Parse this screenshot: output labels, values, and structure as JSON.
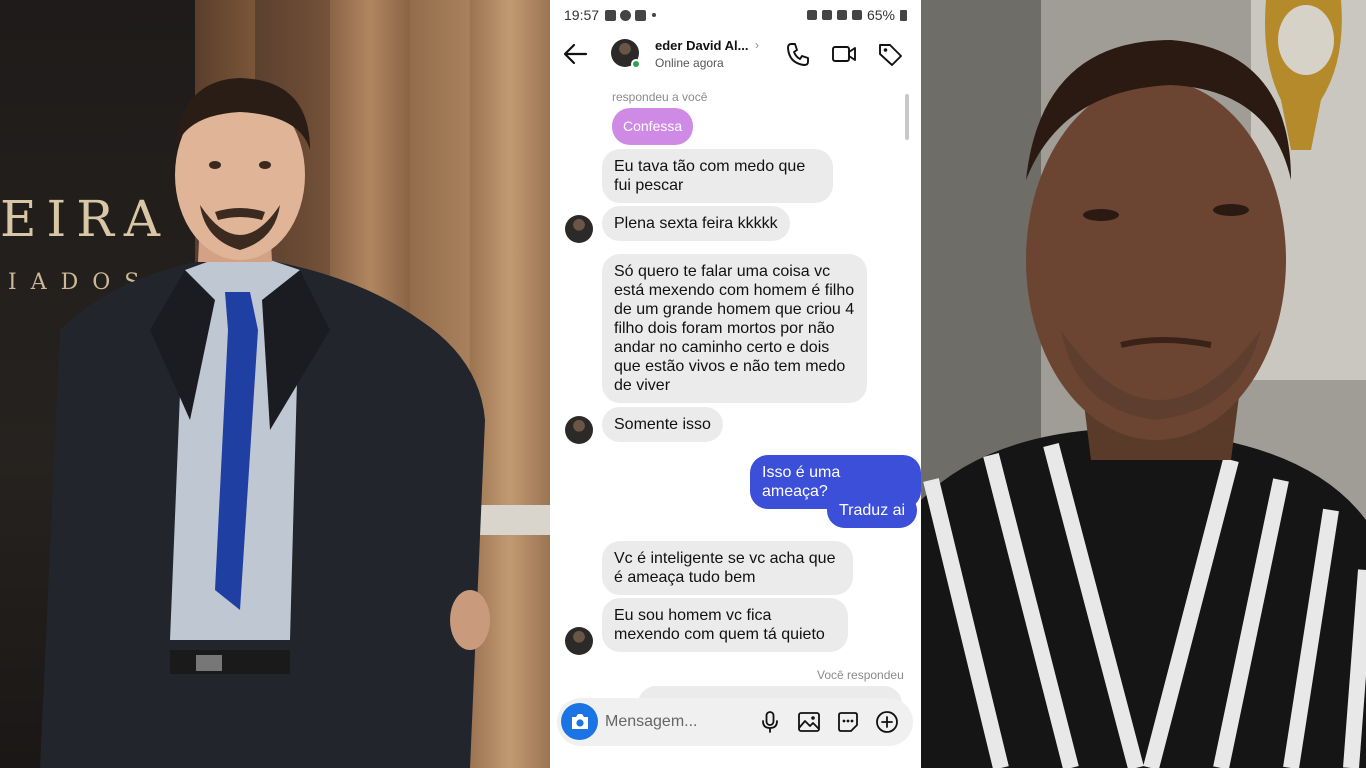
{
  "photos": {
    "left_sign_main": "EIRA",
    "left_sign_sub": "IADOS"
  },
  "status_bar": {
    "time": "19:57",
    "battery": "65%"
  },
  "header": {
    "contact_name": "eder David Al...",
    "contact_status": "Online agora",
    "icons": [
      "back-arrow-icon",
      "phone-icon",
      "video-camera-icon",
      "tag-icon"
    ]
  },
  "messages": [
    {
      "type": "meta",
      "text": "respondeu a você"
    },
    {
      "type": "reply-quote",
      "text": "Confessa"
    },
    {
      "type": "incoming",
      "text": "Eu tava tão com medo que fui pescar"
    },
    {
      "type": "incoming",
      "text": "Plena sexta feira kkkkk"
    },
    {
      "type": "incoming",
      "text": "Só quero te falar uma coisa vc está mexendo com homem é filho de um grande homem que criou 4 filho dois foram mortos por não andar no caminho certo e dois que estão vivos e não tem medo de viver"
    },
    {
      "type": "incoming",
      "text": "Somente isso"
    },
    {
      "type": "outgoing",
      "text": "Isso é uma ameaça?"
    },
    {
      "type": "outgoing",
      "text": "Traduz ai"
    },
    {
      "type": "incoming",
      "text": "Vc é inteligente se vc acha que é ameaça tudo bem"
    },
    {
      "type": "incoming",
      "text": "Eu sou homem vc fica mexendo com quem tá quieto"
    },
    {
      "type": "meta",
      "text": "Você respondeu"
    }
  ],
  "composer": {
    "placeholder": "Mensagem...",
    "icons": [
      "camera-icon",
      "microphone-icon",
      "image-icon",
      "sticker-icon",
      "plus-circle-icon"
    ]
  },
  "colors": {
    "outgoing_bubble": "#3b4fd8",
    "incoming_bubble": "#ebebeb",
    "reply_bubble": "#cf8ae6",
    "online": "#31a24c",
    "camera_button": "#1b74e4"
  }
}
